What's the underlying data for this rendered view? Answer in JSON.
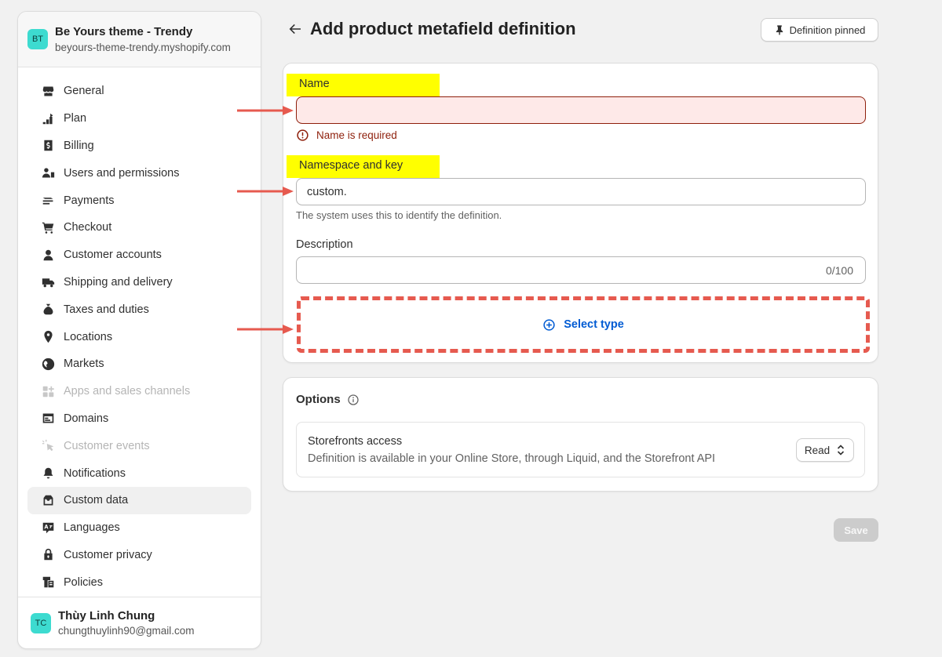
{
  "store": {
    "avatar_initials": "BT",
    "name": "Be Yours theme - Trendy",
    "url": "beyours-theme-trendy.myshopify.com"
  },
  "sidebar": {
    "items": [
      {
        "label": "General",
        "icon": "store-icon",
        "state": "normal"
      },
      {
        "label": "Plan",
        "icon": "plan-icon",
        "state": "normal"
      },
      {
        "label": "Billing",
        "icon": "billing-icon",
        "state": "normal"
      },
      {
        "label": "Users and permissions",
        "icon": "users-icon",
        "state": "normal"
      },
      {
        "label": "Payments",
        "icon": "payments-icon",
        "state": "normal"
      },
      {
        "label": "Checkout",
        "icon": "cart-icon",
        "state": "normal"
      },
      {
        "label": "Customer accounts",
        "icon": "person-icon",
        "state": "normal"
      },
      {
        "label": "Shipping and delivery",
        "icon": "truck-icon",
        "state": "normal"
      },
      {
        "label": "Taxes and duties",
        "icon": "money-bag-icon",
        "state": "normal"
      },
      {
        "label": "Locations",
        "icon": "location-pin-icon",
        "state": "normal"
      },
      {
        "label": "Markets",
        "icon": "globe-icon",
        "state": "normal"
      },
      {
        "label": "Apps and sales channels",
        "icon": "apps-icon",
        "state": "disabled"
      },
      {
        "label": "Domains",
        "icon": "domain-icon",
        "state": "normal"
      },
      {
        "label": "Customer events",
        "icon": "cursor-click-icon",
        "state": "disabled"
      },
      {
        "label": "Notifications",
        "icon": "bell-icon",
        "state": "normal"
      },
      {
        "label": "Custom data",
        "icon": "custom-data-icon",
        "state": "active"
      },
      {
        "label": "Languages",
        "icon": "translate-icon",
        "state": "normal"
      },
      {
        "label": "Customer privacy",
        "icon": "lock-icon",
        "state": "normal"
      },
      {
        "label": "Policies",
        "icon": "policy-icon",
        "state": "normal"
      }
    ]
  },
  "user": {
    "avatar_initials": "TC",
    "name": "Thùy Linh Chung",
    "email": "chungthuylinh90@gmail.com"
  },
  "header": {
    "title": "Add product metafield definition",
    "pin_label": "Definition pinned"
  },
  "form": {
    "name_label": "Name",
    "name_value": "",
    "name_error": "Name is required",
    "namespace_label": "Namespace and key",
    "namespace_value": "custom.",
    "namespace_help": "The system uses this to identify the definition.",
    "description_label": "Description",
    "description_value": "",
    "description_counter": "0/100",
    "select_type_label": "Select type"
  },
  "options": {
    "title": "Options",
    "storefront_title": "Storefronts access",
    "storefront_desc": "Definition is available in your Online Store, through Liquid, and the Storefront API",
    "access_value": "Read"
  },
  "footer": {
    "save_label": "Save"
  },
  "colors": {
    "accent_teal": "#3ddbd0",
    "error": "#8e1f0b",
    "error_bg": "#fee9e8",
    "link_blue": "#005bd3",
    "highlight": "#ffff00",
    "annotation_red": "#e65a4f"
  }
}
